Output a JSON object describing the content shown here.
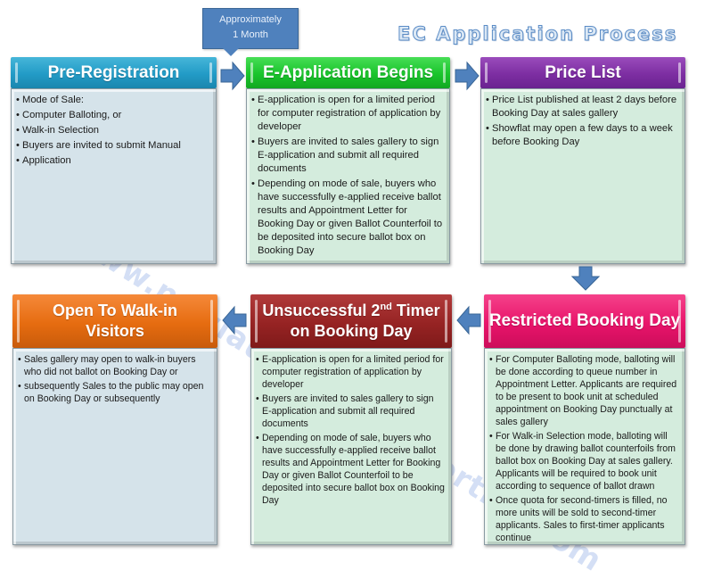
{
  "title": "EC Application Process",
  "callout": {
    "line1": "Approximately",
    "line2": "1 Month"
  },
  "watermark": "www.newlaunchingproperties.com",
  "colors": {
    "pre_registration": "#229bc6",
    "e_application": "#19c42b",
    "price_list": "#7d2ea2",
    "restricted_booking": "#e8146a",
    "unsuccessful": "#962323",
    "walk_in": "#e66c10",
    "arrow": "#4f81bd"
  },
  "steps": [
    {
      "title": "Pre-Registration",
      "bullets": [
        "Mode of Sale:",
        " Computer Balloting, or",
        " Walk-in Selection",
        "Buyers are invited to submit Manual",
        "Application"
      ]
    },
    {
      "title": "E-Application Begins",
      "bullets": [
        "E-application is open for a limited period for computer registration of application by developer",
        "Buyers are invited to sales gallery to sign E-application and submit all required documents",
        "Depending on mode of sale, buyers who have successfully e-applied receive ballot results and Appointment Letter for Booking Day or given Ballot Counterfoil to be deposited into secure ballot box on Booking Day"
      ]
    },
    {
      "title": "Price List",
      "bullets": [
        "Price List published at least 2 days before Booking Day at sales gallery",
        "Showflat may open a few days to a week before Booking Day"
      ]
    },
    {
      "title": "Restricted Booking Day",
      "bullets": [
        "For Computer Balloting mode, balloting will be done according to queue number in Appointment Letter. Applicants are required to be present to book unit at scheduled appointment on Booking Day punctually at sales gallery",
        "For Walk-in Selection mode, balloting will be done by drawing ballot counterfoils from ballot box on Booking Day at sales gallery. Applicants will be required to book unit according to sequence of ballot drawn",
        "Once quota for second-timers is filled, no more units will be sold to second-timer applicants. Sales to first-timer applicants continue"
      ]
    },
    {
      "title_part1": "Unsuccessful 2",
      "title_sup": "nd",
      "title_part2": " Timer",
      "title_line2": "on Booking Day",
      "bullets": [
        "E-application is open for a limited period for computer registration of application by developer",
        "Buyers are invited to sales gallery to sign E-application and submit all required documents",
        "Depending on mode of sale, buyers who have successfully e-applied receive ballot results and Appointment Letter for Booking Day or given Ballot Counterfoil to be deposited into secure ballot box on Booking Day"
      ]
    },
    {
      "title_line1": "Open To Walk-in",
      "title_line2": "Visitors",
      "bullets": [
        "Sales gallery may open to walk-in buyers who did not ballot on Booking Day or",
        "subsequently Sales to the public may open on Booking Day or subsequently"
      ]
    }
  ]
}
